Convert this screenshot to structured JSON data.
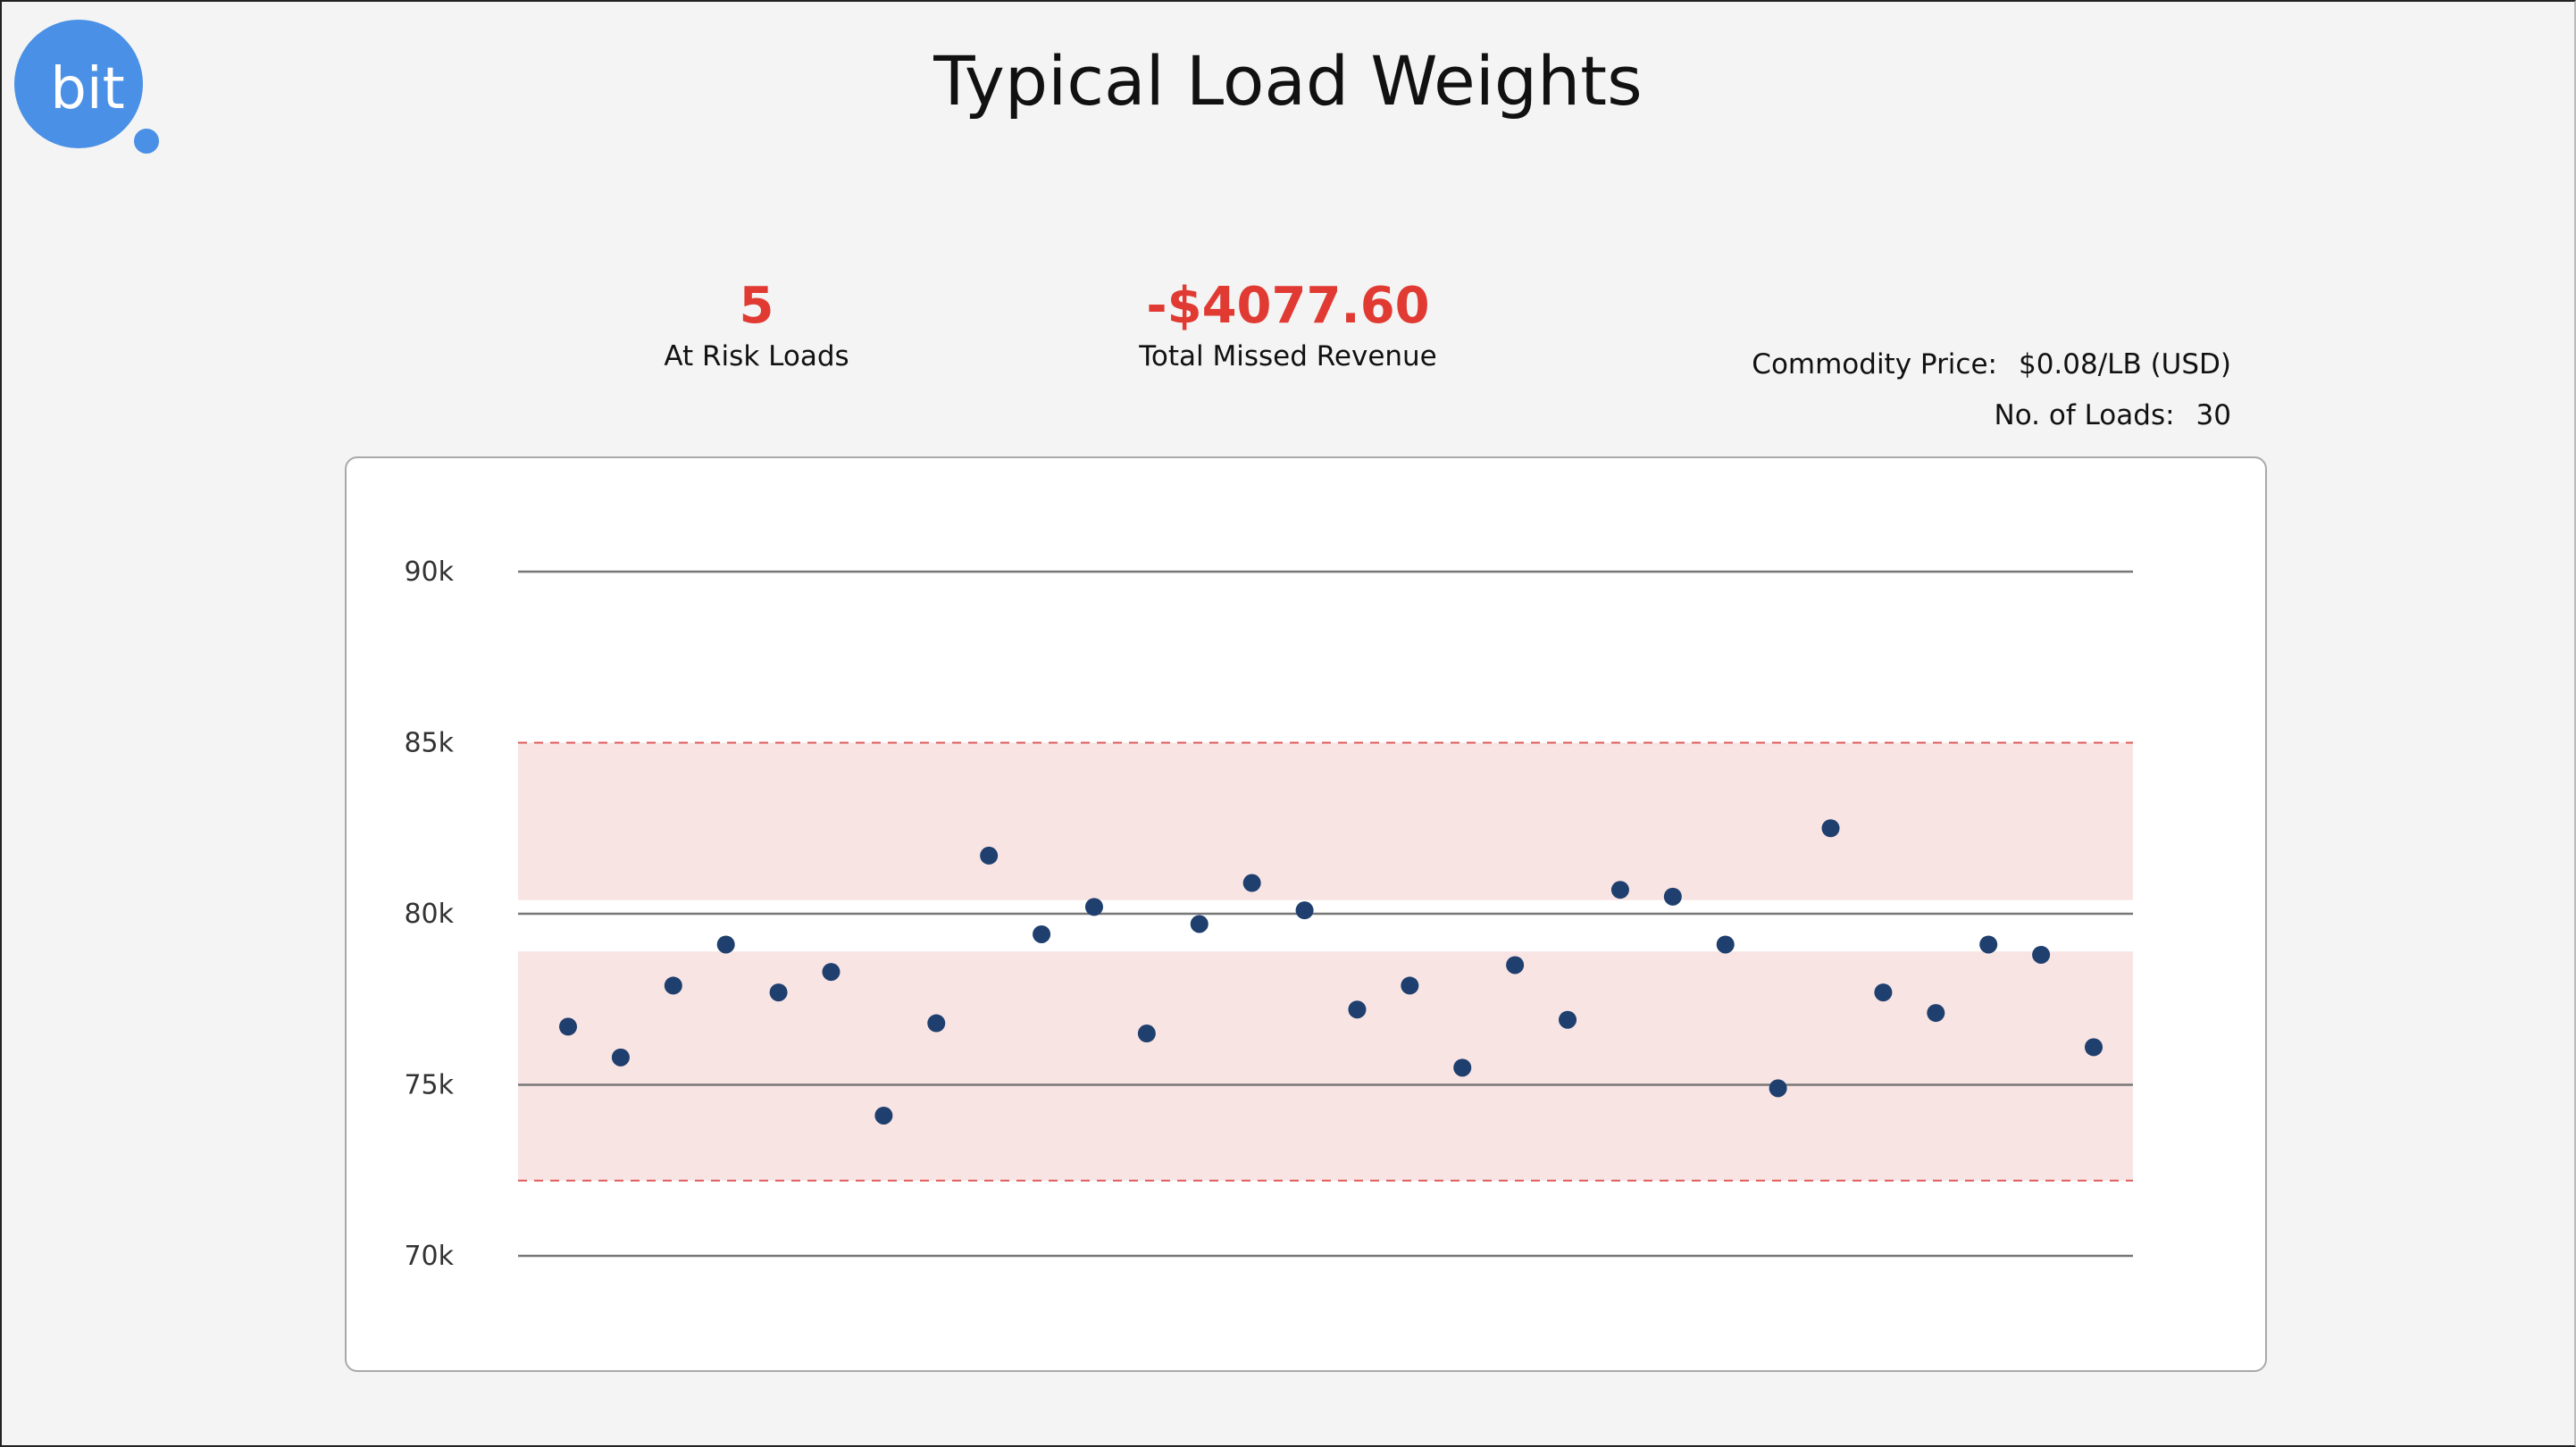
{
  "header": {
    "logo_text": "bit",
    "title": "Typical Load Weights"
  },
  "kpis": {
    "at_risk": {
      "value": "5",
      "label": "At Risk Loads"
    },
    "missed_revenue": {
      "value": "-$4077.60",
      "label": "Total Missed Revenue"
    }
  },
  "meta": {
    "commodity_price_label": "Commodity Price:",
    "commodity_price_value": "$0.08/LB (USD)",
    "loads_label": "No. of Loads:",
    "loads_value": "30"
  },
  "colors": {
    "accent": "#4a90e6",
    "risk_text": "#e03a32",
    "point": "#1f3f6e",
    "band": "#f9e4e4",
    "band_limit": "#e05a5a",
    "gridline": "#777777"
  },
  "chart_data": {
    "type": "scatter",
    "title": "",
    "xlabel": "",
    "ylabel": "",
    "ylim": [
      70000,
      90000
    ],
    "yticks": [
      70000,
      75000,
      80000,
      85000,
      90000
    ],
    "ytick_labels": [
      "70k",
      "75k",
      "80k",
      "85k",
      "90k"
    ],
    "target_weight": 80000,
    "upper_limit": 85000,
    "lower_limit": 72200,
    "inner_band_upper": 80400,
    "inner_band_lower": 78900,
    "grid": true,
    "legend": "none",
    "series": [
      {
        "values": [
          76700,
          75800,
          77900,
          79100,
          77700,
          78300,
          74100,
          76800,
          81700,
          79400,
          80200,
          76500,
          79700,
          80900,
          80100,
          77200,
          77900,
          75500,
          78500,
          76900,
          80700,
          80500,
          79100,
          74900,
          82500,
          77700,
          77100,
          79100,
          78800,
          76100
        ]
      }
    ]
  }
}
